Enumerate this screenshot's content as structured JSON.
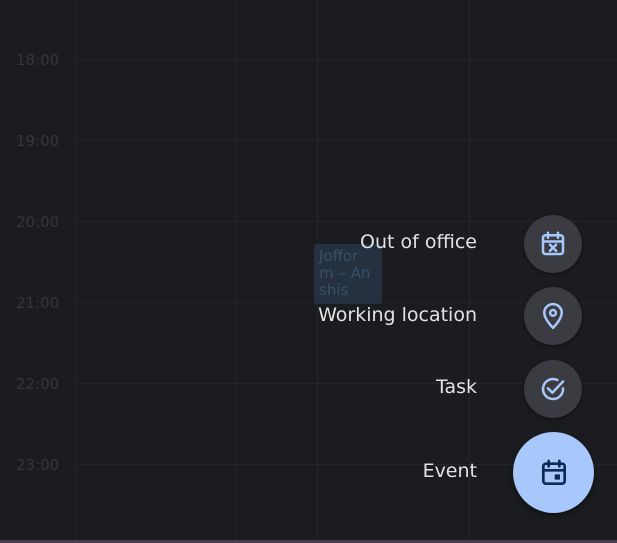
{
  "calendar": {
    "times": [
      "18:00",
      "19:00",
      "20:00",
      "21:00",
      "22:00",
      "23:00"
    ],
    "event_chip": {
      "title": "Joffor m – Anshis"
    }
  },
  "fab_menu": {
    "items": [
      {
        "label": "Out of office",
        "icon": "calendar-x-icon"
      },
      {
        "label": "Working location",
        "icon": "location-pin-icon"
      },
      {
        "label": "Task",
        "icon": "check-circle-icon"
      }
    ],
    "primary": {
      "label": "Event",
      "icon": "calendar-event-icon"
    }
  },
  "colors": {
    "background": "#1b1c1f",
    "mini_fab": "#3a3c41",
    "primary_fab": "#a8c7fa",
    "icon_accent": "#a8c7fa",
    "primary_icon": "#0b2a57"
  }
}
